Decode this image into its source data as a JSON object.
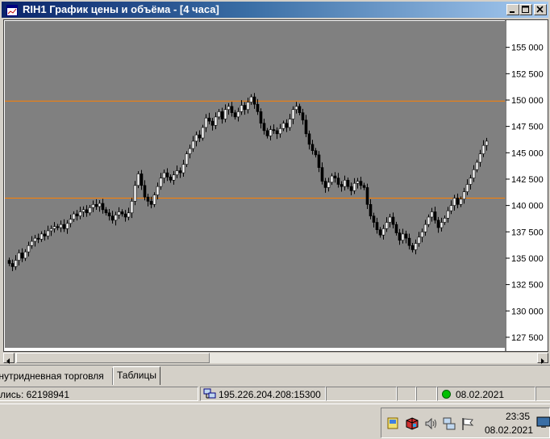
{
  "window": {
    "title": "RIH1 График цены и объёма - [4 часа]"
  },
  "tabs": {
    "items": [
      {
        "label": "внутридневная торговля"
      },
      {
        "label": "Таблицы"
      }
    ]
  },
  "statusbar": {
    "account": "лись: 62198941",
    "server": "195.226.204.208:15300",
    "date": "08.02.2021",
    "connection_color": "#00c000"
  },
  "taskbar": {
    "time": "23:35",
    "date": "08.02.2021"
  },
  "colors": {
    "plot_background": "#808080",
    "candle_color": "#000000",
    "level_line": "#ff8000"
  },
  "chart_data": {
    "type": "candlestick",
    "title": "",
    "xlabel": "",
    "ylabel": "",
    "ylim": [
      126500,
      157500
    ],
    "y_ticks": [
      127500,
      130000,
      132500,
      135000,
      137500,
      140000,
      142500,
      145000,
      147500,
      150000,
      152500,
      155000
    ],
    "y_tick_labels": [
      "127 500",
      "130 000",
      "132 500",
      "135 000",
      "137 500",
      "140 000",
      "142 500",
      "145 000",
      "147 500",
      "150 000",
      "152 500",
      "155 000"
    ],
    "horizontal_lines": [
      149900,
      140700
    ],
    "grid": false,
    "closes": [
      134500,
      134200,
      134800,
      135500,
      135000,
      135600,
      136200,
      136600,
      136900,
      136800,
      137300,
      137100,
      137600,
      137800,
      138000,
      137900,
      138200,
      137800,
      138300,
      138700,
      139200,
      139000,
      139400,
      139600,
      139300,
      139800,
      140100,
      139900,
      140200,
      139600,
      139300,
      139000,
      138600,
      139100,
      139400,
      139200,
      138900,
      139300,
      140400,
      141900,
      143000,
      141900,
      140800,
      140400,
      140100,
      141000,
      141800,
      142600,
      143100,
      142700,
      142400,
      142900,
      143300,
      143100,
      143900,
      144900,
      145400,
      146100,
      146700,
      146400,
      147400,
      148300,
      148000,
      147600,
      148400,
      148900,
      148200,
      149100,
      149400,
      148800,
      148400,
      148900,
      149500,
      149100,
      149800,
      150300,
      149600,
      148900,
      147800,
      147100,
      146600,
      147200,
      147100,
      146800,
      147300,
      147800,
      147400,
      148200,
      149100,
      149400,
      148800,
      148100,
      146800,
      145800,
      145200,
      144800,
      143600,
      142300,
      141700,
      142200,
      142800,
      142600,
      142000,
      141800,
      142400,
      141800,
      141400,
      142100,
      142300,
      141900,
      141700,
      140100,
      139000,
      138400,
      137700,
      137200,
      137800,
      138400,
      138900,
      138200,
      137400,
      136700,
      137300,
      136900,
      136200,
      135800,
      136400,
      137000,
      137500,
      138200,
      138900,
      139400,
      138600,
      137900,
      138400,
      138800,
      139500,
      140000,
      140700,
      140100,
      140600,
      141300,
      142000,
      142600,
      143400,
      144100,
      144900,
      145700,
      146100
    ]
  }
}
